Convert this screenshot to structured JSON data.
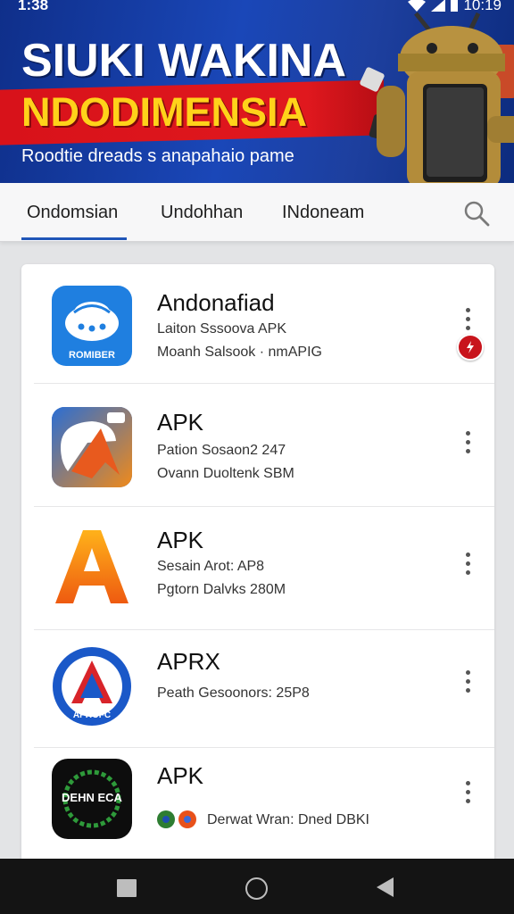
{
  "status_bar": {
    "time_left": "1:38",
    "time_right": "10:19",
    "icons": [
      "wifi-icon",
      "signal-icon",
      "battery-icon"
    ]
  },
  "hero": {
    "title": "SIUKI WAKINA",
    "subtitle": "NDODIMENSIA",
    "tagline": "Roodtie dreads s anapahaio pame",
    "colors": {
      "background": "#1a47b8",
      "stripe": "#d8121a",
      "title": "#ffffff",
      "subtitle": "#ffd21a"
    }
  },
  "tabs": {
    "items": [
      {
        "label": "Ondomsian",
        "active": true
      },
      {
        "label": "Undohhan",
        "active": false
      },
      {
        "label": "INdoneam",
        "active": false
      }
    ],
    "search_icon": "search-icon",
    "accent": "#2056b8"
  },
  "apps": [
    {
      "name": "Andonafiad",
      "line1": "Laiton Sssoova APK",
      "line2": "Moanh Salsook · nmAPIG",
      "icon_label": "ROMIBER",
      "icon": "cloud-app-icon",
      "badge": true
    },
    {
      "name": "APK",
      "line1": "Pation Sosaon2 247",
      "line2": "Ovann Duoltenk SBM",
      "icon_label": "",
      "icon": "chat-arrow-app-icon",
      "badge": false
    },
    {
      "name": "APK",
      "line1": "Sesain Arot: AP8",
      "line2": "Pgtorn Dalvks 280M",
      "icon_label": "",
      "icon": "letter-a-app-icon",
      "badge": false
    },
    {
      "name": "APRX",
      "line1": "Peath Gesoonors: 25P8",
      "line2": "",
      "icon_label": "APROFC",
      "icon": "circle-a-app-icon",
      "badge": false
    },
    {
      "name": "APK",
      "line1": "Derwat Wran: Dned DBKI",
      "line2": "",
      "icon_label": "DEHN ECA",
      "icon": "laurel-app-icon",
      "badge": false
    }
  ],
  "nav": {
    "recent": "recent-apps-icon",
    "home": "home-icon",
    "back": "back-icon"
  }
}
